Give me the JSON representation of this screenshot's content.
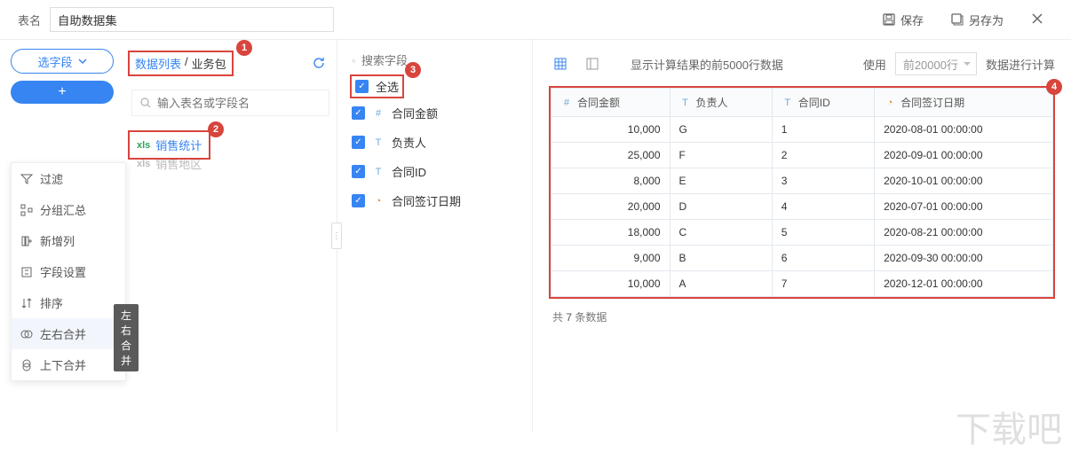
{
  "header": {
    "table_label": "表名",
    "table_name": "自助数据集",
    "save": "保存",
    "save_as": "另存为"
  },
  "col1": {
    "select_field": "选字段",
    "ops": {
      "filter": "过滤",
      "group": "分组汇总",
      "newcol": "新增列",
      "fieldset": "字段设置",
      "sort": "排序",
      "ljoin": "左右合并",
      "vjoin": "上下合并"
    },
    "tooltip": "左右合并"
  },
  "col2": {
    "tab_a": "数据列表",
    "tab_b": "业务包",
    "search_ph": "输入表名或字段名",
    "item1": "销售统计",
    "item2": "销售地区",
    "badge1": "1",
    "badge2": "2"
  },
  "col3": {
    "search_ph": "搜索字段",
    "select_all": "全选",
    "f1": "合同金额",
    "f2": "负责人",
    "f3": "合同ID",
    "f4": "合同签订日期",
    "badge3": "3"
  },
  "col4": {
    "info_text": "显示计算结果的前5000行数据",
    "use_label": "使用",
    "rows_opt": "前20000行",
    "calc_label": "数据进行计算",
    "badge4": "4",
    "columns": {
      "c1": "合同金额",
      "c2": "负责人",
      "c3": "合同ID",
      "c4": "合同签订日期"
    },
    "footer_prefix": "共",
    "footer_count": "7",
    "footer_suffix": "条数据"
  },
  "chart_data": {
    "type": "table",
    "columns": [
      "合同金额",
      "负责人",
      "合同ID",
      "合同签订日期"
    ],
    "rows": [
      {
        "amount": "10,000",
        "owner": "G",
        "id": "1",
        "date": "2020-08-01 00:00:00"
      },
      {
        "amount": "25,000",
        "owner": "F",
        "id": "2",
        "date": "2020-09-01 00:00:00"
      },
      {
        "amount": "8,000",
        "owner": "E",
        "id": "3",
        "date": "2020-10-01 00:00:00"
      },
      {
        "amount": "20,000",
        "owner": "D",
        "id": "4",
        "date": "2020-07-01 00:00:00"
      },
      {
        "amount": "18,000",
        "owner": "C",
        "id": "5",
        "date": "2020-08-21 00:00:00"
      },
      {
        "amount": "9,000",
        "owner": "B",
        "id": "6",
        "date": "2020-09-30 00:00:00"
      },
      {
        "amount": "10,000",
        "owner": "A",
        "id": "7",
        "date": "2020-12-01 00:00:00"
      }
    ]
  }
}
